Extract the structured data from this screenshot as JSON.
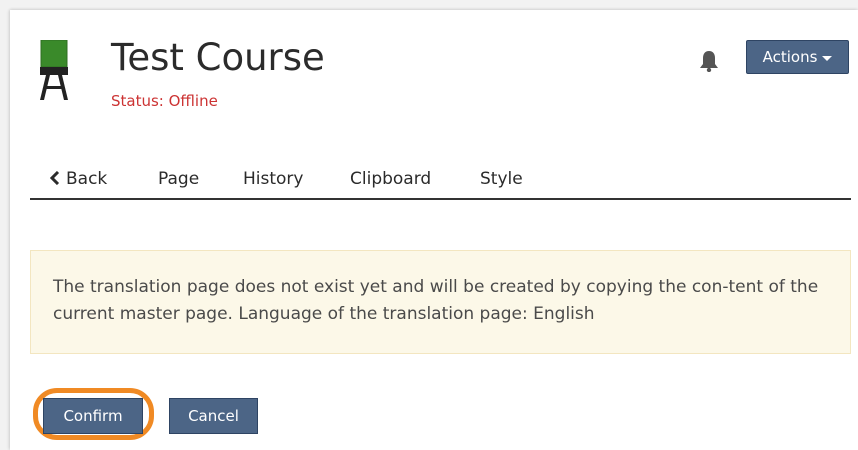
{
  "header": {
    "course_title": "Test Course",
    "status": "Status: Offline",
    "status_color": "#cc3333",
    "actions_label": "Actions",
    "icons": {
      "course": "easel-board-icon",
      "notifications": "bell-icon",
      "actions_caret": "caret-down-icon"
    }
  },
  "tabs": [
    {
      "label": "Back",
      "icon": "chevron-left-icon"
    },
    {
      "label": "Page"
    },
    {
      "label": "History"
    },
    {
      "label": "Clipboard"
    },
    {
      "label": "Style"
    }
  ],
  "message": {
    "text": "The translation page does not exist yet and will be created by copying the con-tent of the current master page. Language of the translation page: English",
    "background": "#fcf8e8"
  },
  "buttons": {
    "confirm_label": "Confirm",
    "cancel_label": "Cancel",
    "color": "#4c6586",
    "highlight_color": "#f08a24"
  }
}
